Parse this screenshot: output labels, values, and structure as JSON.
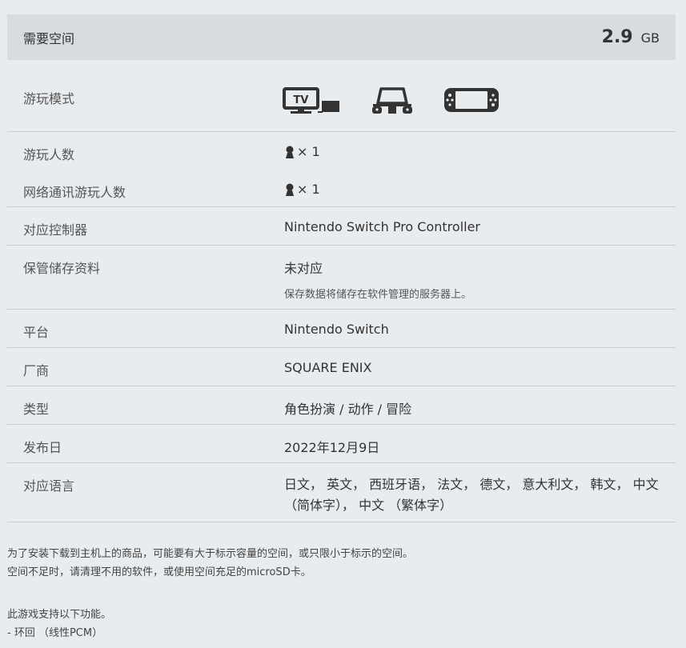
{
  "storage": {
    "label": "需要空间",
    "value": "2.9",
    "unit": "GB"
  },
  "specs": {
    "play_mode": {
      "label": "游玩模式",
      "icons": [
        "tv-mode-icon",
        "tabletop-mode-icon",
        "handheld-mode-icon"
      ]
    },
    "players": {
      "label": "游玩人数",
      "value": "× 1"
    },
    "online_players": {
      "label": "网络通讯游玩人数",
      "value": "× 1"
    },
    "controller": {
      "label": "对应控制器",
      "value": "Nintendo Switch Pro Controller"
    },
    "save_data": {
      "label": "保管储存资料",
      "value": "未对应",
      "note": "保存数据将储存在软件管理的服务器上。"
    },
    "platform": {
      "label": "平台",
      "value": "Nintendo Switch"
    },
    "publisher": {
      "label": "厂商",
      "value": "SQUARE ENIX"
    },
    "genre": {
      "label": "类型",
      "value": "角色扮演 / 动作 / 冒险"
    },
    "release": {
      "label": "发布日",
      "value": "2022年12月9日"
    },
    "languages": {
      "label": "对应语言",
      "value": "日文， 英文， 西班牙语， 法文， 德文， 意大利文， 韩文， 中文 （简体字）， 中文 （繁体字）"
    }
  },
  "notes": {
    "line1": "为了安装下载到主机上的商品，可能要有大于标示容量的空间，或只限小于标示的空间。",
    "line2": "空间不足时，请清理不用的软件，或使用空间充足的microSD卡。",
    "line3": "此游戏支持以下功能。",
    "line4": "- 环回 （线性PCM）"
  },
  "colors": {
    "background": "#e9ecef",
    "bar": "#d8dbdf",
    "divider": "#c9ccd0",
    "text": "#333333"
  }
}
